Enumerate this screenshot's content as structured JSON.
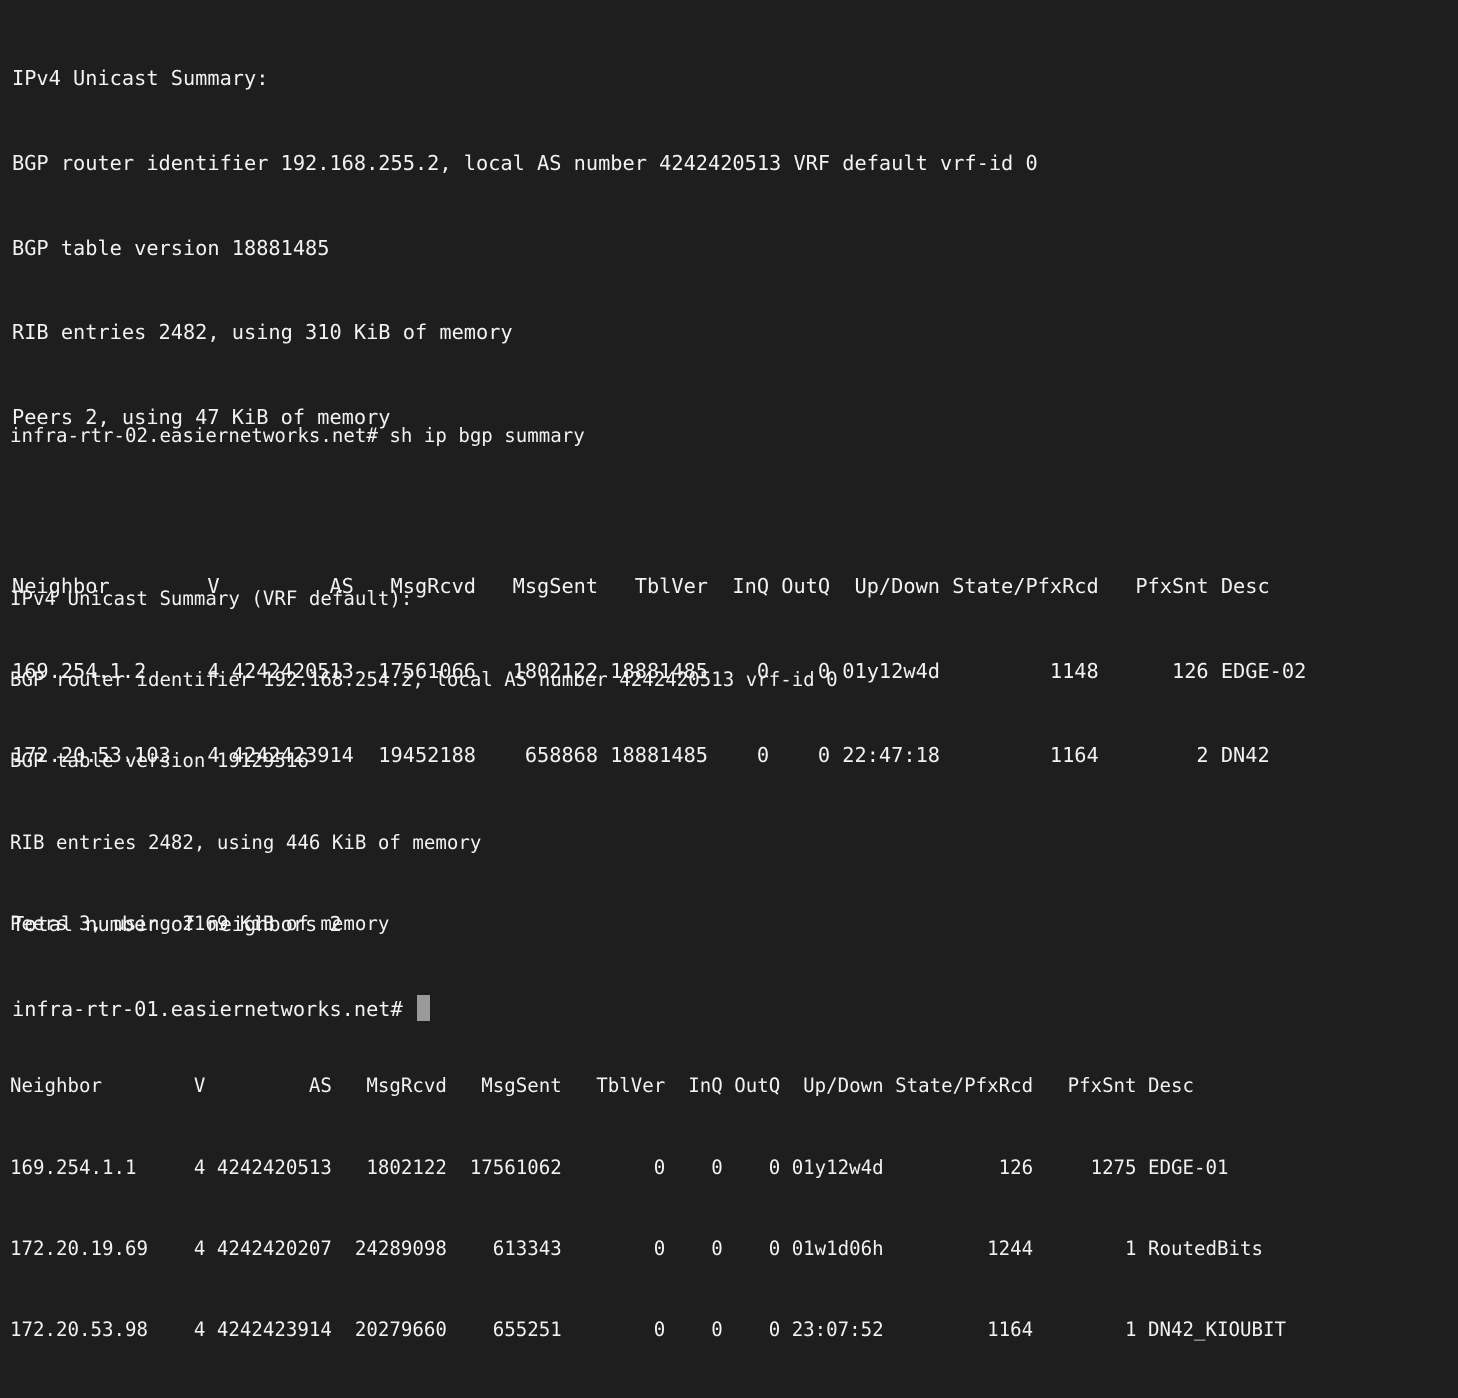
{
  "pane_a": {
    "lines": [
      "IPv4 Unicast Summary:",
      "BGP router identifier 192.168.255.2, local AS number 4242420513 VRF default vrf-id 0",
      "BGP table version 18881485",
      "RIB entries 2482, using 310 KiB of memory",
      "Peers 2, using 47 KiB of memory",
      "",
      "Neighbor        V         AS   MsgRcvd   MsgSent   TblVer  InQ OutQ  Up/Down State/PfxRcd   PfxSnt Desc",
      "169.254.1.2     4 4242420513  17561066   1802122 18881485    0    0 01y12w4d         1148      126 EDGE-02",
      "172.20.53.103   4 4242423914  19452188    658868 18881485    0    0 22:47:18         1164        2 DN42",
      "",
      "Total number of neighbors 2"
    ],
    "prompt": "infra-rtr-01.easiernetworks.net# "
  },
  "pane_b": {
    "lines": [
      "infra-rtr-02.easiernetworks.net# sh ip bgp summary",
      "",
      "IPv4 Unicast Summary (VRF default):",
      "BGP router identifier 192.168.254.2, local AS number 4242420513 vrf-id 0",
      "BGP table version 19129516",
      "RIB entries 2482, using 446 KiB of memory",
      "Peers 3, using 2169 KiB of memory",
      "",
      "Neighbor        V         AS   MsgRcvd   MsgSent   TblVer  InQ OutQ  Up/Down State/PfxRcd   PfxSnt Desc",
      "169.254.1.1     4 4242420513   1802122  17561062        0    0    0 01y12w4d          126     1275 EDGE-01",
      "172.20.19.69    4 4242420207  24289098    613343        0    0    0 01w1d06h         1244        1 RoutedBits",
      "172.20.53.98    4 4242423914  20279660    655251        0    0    0 23:07:52         1164        1 DN42_KIOUBIT"
    ]
  }
}
